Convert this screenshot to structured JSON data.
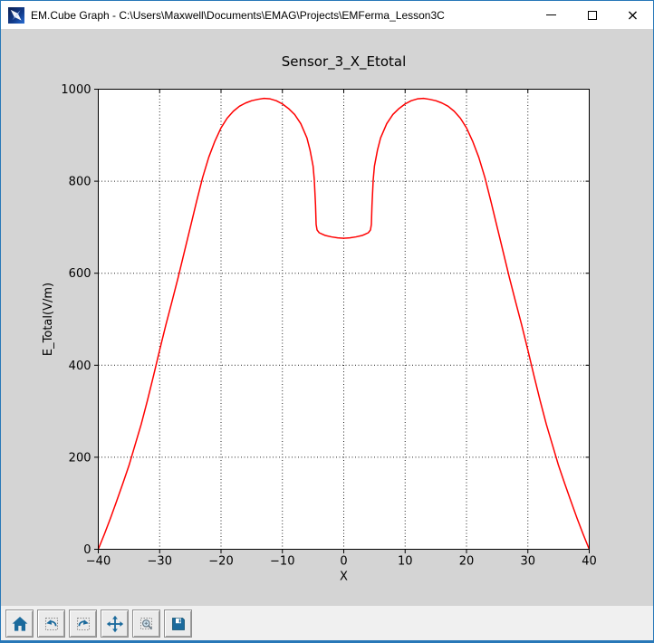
{
  "window": {
    "title": "EM.Cube Graph - C:\\Users\\Maxwell\\Documents\\EMAG\\Projects\\EMFerma_Lesson3C",
    "controls": {
      "minimize": "minimize",
      "maximize": "maximize",
      "close": "×"
    }
  },
  "colors": {
    "window_border": "#2878b8",
    "titlebar_bg": "#ffffff",
    "figure_bg": "#d4d4d4",
    "plot_bg": "#ffffff",
    "grid": "#000000",
    "curve": "#ff0000",
    "toolbar_bg": "#f0f0f0",
    "toolbar_icon": "#1b6a9c"
  },
  "toolbar": {
    "buttons": [
      {
        "name": "home"
      },
      {
        "name": "back"
      },
      {
        "name": "forward"
      },
      {
        "name": "pan"
      },
      {
        "name": "zoom-to-rect"
      },
      {
        "name": "save"
      }
    ]
  },
  "chart_data": {
    "type": "line",
    "title": "Sensor_3_X_Etotal",
    "xlabel": "X",
    "ylabel": "E_Total(V/m)",
    "xlim": [
      -40,
      40
    ],
    "ylim": [
      0,
      1000
    ],
    "xticks": [
      -40,
      -30,
      -20,
      -10,
      0,
      10,
      20,
      30,
      40
    ],
    "yticks": [
      0,
      200,
      400,
      600,
      800,
      1000
    ],
    "grid": true,
    "grid_style": "dotted",
    "legend": false,
    "series": [
      {
        "name": "E_Total",
        "color": "#ff0000",
        "points": [
          [
            -40,
            0
          ],
          [
            -39,
            33
          ],
          [
            -38,
            68
          ],
          [
            -37,
            105
          ],
          [
            -36,
            143
          ],
          [
            -35,
            182
          ],
          [
            -34,
            227
          ],
          [
            -33,
            272
          ],
          [
            -32,
            323
          ],
          [
            -31,
            377
          ],
          [
            -30,
            433
          ],
          [
            -29,
            487
          ],
          [
            -28,
            538
          ],
          [
            -27,
            590
          ],
          [
            -26,
            645
          ],
          [
            -25,
            700
          ],
          [
            -24,
            755
          ],
          [
            -23,
            808
          ],
          [
            -22,
            852
          ],
          [
            -21,
            887
          ],
          [
            -20,
            916
          ],
          [
            -19,
            937
          ],
          [
            -18,
            952
          ],
          [
            -17,
            963
          ],
          [
            -16,
            970
          ],
          [
            -15,
            975
          ],
          [
            -14,
            978
          ],
          [
            -13,
            980
          ],
          [
            -12,
            979
          ],
          [
            -11,
            975
          ],
          [
            -10,
            968
          ],
          [
            -9,
            958
          ],
          [
            -8,
            945
          ],
          [
            -7,
            925
          ],
          [
            -6,
            894
          ],
          [
            -5.5,
            868
          ],
          [
            -5,
            833
          ],
          [
            -4.8,
            803
          ],
          [
            -4.6,
            748
          ],
          [
            -4.5,
            706
          ],
          [
            -4.35,
            694
          ],
          [
            -4,
            688
          ],
          [
            -3.5,
            685
          ],
          [
            -3,
            682
          ],
          [
            -2,
            679
          ],
          [
            -1,
            677
          ],
          [
            0,
            676
          ],
          [
            1,
            677
          ],
          [
            2,
            679
          ],
          [
            3,
            682
          ],
          [
            3.5,
            685
          ],
          [
            4,
            688
          ],
          [
            4.35,
            694
          ],
          [
            4.5,
            706
          ],
          [
            4.6,
            748
          ],
          [
            4.8,
            803
          ],
          [
            5,
            833
          ],
          [
            5.5,
            868
          ],
          [
            6,
            894
          ],
          [
            7,
            925
          ],
          [
            8,
            945
          ],
          [
            9,
            958
          ],
          [
            10,
            968
          ],
          [
            11,
            975
          ],
          [
            12,
            979
          ],
          [
            13,
            980
          ],
          [
            14,
            978
          ],
          [
            15,
            975
          ],
          [
            16,
            970
          ],
          [
            17,
            963
          ],
          [
            18,
            952
          ],
          [
            19,
            937
          ],
          [
            20,
            916
          ],
          [
            21,
            887
          ],
          [
            22,
            852
          ],
          [
            23,
            808
          ],
          [
            24,
            755
          ],
          [
            25,
            700
          ],
          [
            26,
            645
          ],
          [
            27,
            590
          ],
          [
            28,
            538
          ],
          [
            29,
            487
          ],
          [
            30,
            433
          ],
          [
            31,
            377
          ],
          [
            32,
            323
          ],
          [
            33,
            272
          ],
          [
            34,
            227
          ],
          [
            35,
            182
          ],
          [
            36,
            143
          ],
          [
            37,
            105
          ],
          [
            38,
            68
          ],
          [
            39,
            33
          ],
          [
            40,
            0
          ]
        ]
      }
    ]
  }
}
